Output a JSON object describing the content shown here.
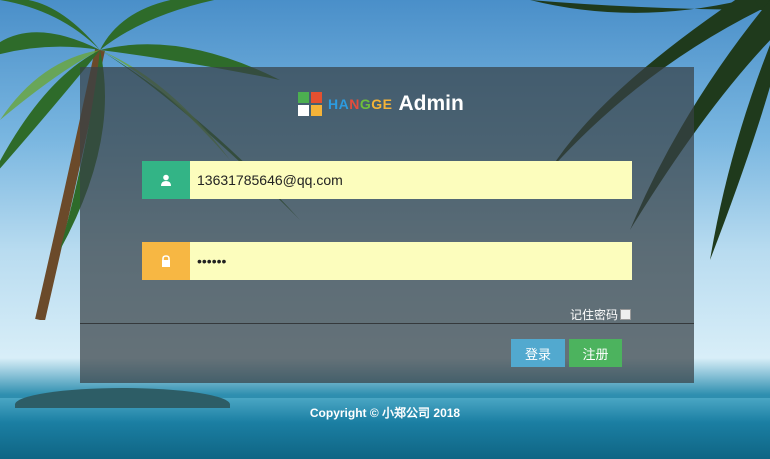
{
  "brand": {
    "letters": [
      {
        "ch": "H",
        "color": "#2c9be0"
      },
      {
        "ch": "A",
        "color": "#2c9be0"
      },
      {
        "ch": "N",
        "color": "#e44c3c"
      },
      {
        "ch": "G",
        "color": "#6fbf3b"
      },
      {
        "ch": "G",
        "color": "#f5b338"
      },
      {
        "ch": "E",
        "color": "#f5b338"
      }
    ],
    "admin": "Admin",
    "logo_colors": [
      "#4caf50",
      "#e4502f",
      "#ffffff",
      "#f5b338"
    ]
  },
  "login": {
    "username_value": "13631785646@qq.com",
    "password_value": "••••••",
    "remember_label": "记住密码",
    "login_button": "登录",
    "register_button": "注册"
  },
  "footer": {
    "copyright": "Copyright © 小郑公司 2018"
  }
}
